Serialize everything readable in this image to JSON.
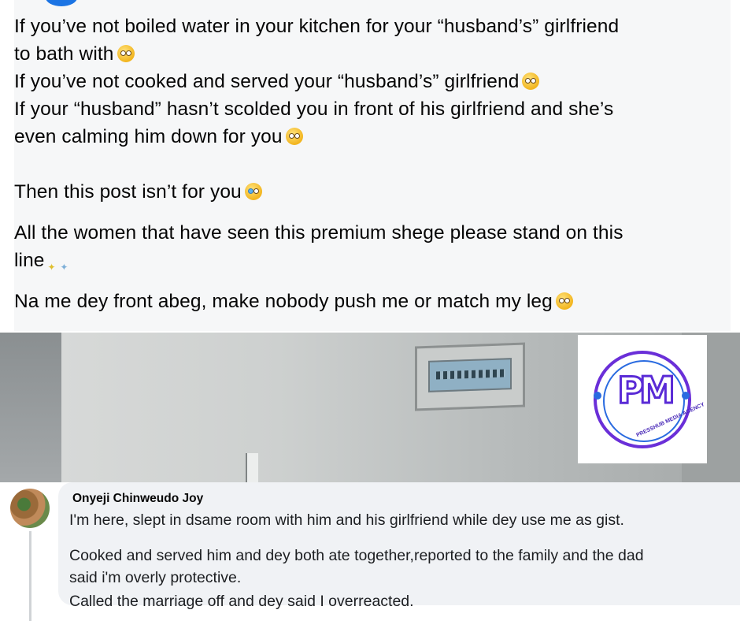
{
  "post": {
    "paragraphs": [
      {
        "lines": [
          {
            "text": "If you’ve not boiled water in your kitchen for your “husband’s” girlfriend",
            "emoji": ""
          },
          {
            "text": "to bath with",
            "emoji": "dizzy-face"
          },
          {
            "text": "If you’ve not cooked and served your “husband’s” girlfriend",
            "emoji": "dizzy-face"
          },
          {
            "text": "If your “husband” hasn’t scolded you in front of his girlfriend and she’s",
            "emoji": ""
          },
          {
            "text": "even calming him down for you",
            "emoji": "dizzy-face"
          }
        ]
      },
      {
        "lines": [
          {
            "text": "Then this post isn’t for you",
            "emoji": "crying-face"
          }
        ]
      },
      {
        "lines": [
          {
            "text": "All the women that have seen this premium shege please stand on this",
            "emoji": ""
          },
          {
            "text": "line",
            "emoji": "sparkles"
          }
        ]
      },
      {
        "lines": [
          {
            "text": "Na me dey front abeg, make nobody push me or match my leg",
            "emoji": "dizzy-face"
          }
        ]
      }
    ]
  },
  "watermark": {
    "letters": "PM",
    "arc_text": "PRESSHUB MEDIA AGENCY",
    "colors": {
      "ring": "#6a2fd8",
      "accent": "#2a6be0"
    }
  },
  "comment": {
    "author": "Onyeji Chinweudo Joy",
    "lines": [
      "I'm here, slept in dsame room with him and his girlfriend while dey use me as gist.",
      "Cooked and served him and dey both ate together,reported to the family and the dad",
      "said i'm overly protective.",
      "Called the marriage off and dey said I overreacted."
    ]
  }
}
